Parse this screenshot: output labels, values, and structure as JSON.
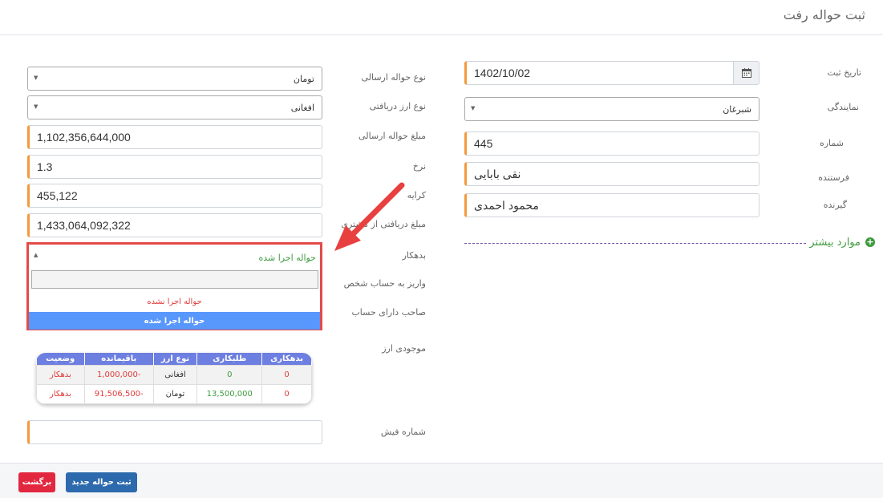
{
  "header": {
    "title": "ثبت حواله رفت"
  },
  "right_form": {
    "date_label": "تاریخ ثبت",
    "date_value": "1402/10/02",
    "agency_label": "نمایندگی",
    "agency_value": "شبرغان",
    "number_label": "شماره",
    "number_value": "445",
    "sender_label": "فرستنده",
    "sender_value": "نقی بابایی",
    "receiver_label": "گیرنده",
    "receiver_value": "محمود احمدی",
    "more_label": "موارد بیشتر"
  },
  "left_form": {
    "send_type_label": "نوع حواله ارسالی",
    "send_type_value": "تومان",
    "receive_currency_label": "نوع ارز دریافتی",
    "receive_currency_value": "افغانی",
    "send_amount_label": "مبلغ حواله ارسالی",
    "send_amount_value": "1,102,356,644,000",
    "rate_label": "نرخ",
    "rate_value": "1.3",
    "fee_label": "کرایه",
    "fee_value": "455,122",
    "received_amount_label": "مبلغ دریافتی از مشتری",
    "received_amount_value": "1,433,064,092,322",
    "debtor_label": "بدهکار",
    "deposit_label": "واریز به حساب شخص",
    "account_owner_label": "صاحب دارای حساب",
    "currency_balance_label": "موجودی ارز",
    "receipt_label": "شماره فیش",
    "receipt_value": ""
  },
  "dropdown": {
    "selected": "حواله اجرا شده",
    "search_value": "",
    "options": [
      "حواله اجرا نشده",
      "حواله اجرا شده"
    ]
  },
  "balance_table": {
    "headers": [
      "بدهکاری",
      "طلبکاری",
      "نوع ارز",
      "باقیمانده",
      "وضعیت"
    ],
    "rows": [
      [
        "0",
        "0",
        "افغانی",
        "-1,000,000",
        "بدهکار"
      ],
      [
        "0",
        "13,500,000",
        "تومان",
        "-91,506,500",
        "بدهکار"
      ]
    ]
  },
  "footer": {
    "back_label": "برگشت",
    "new_label": "ثبت حواله جدید"
  },
  "colors": {
    "accent_border": "#f29a3c",
    "highlight_red": "#e34a4a",
    "selected_option": "#5897fb",
    "table_header": "#6d7fe0",
    "more_green": "#3e9b3e",
    "back_button": "#e2283f",
    "new_button": "#2c6aad"
  },
  "icons": {
    "date": "calendar-icon",
    "more": "plus-circle-icon",
    "dropdown": "caret-down-icon",
    "annotation": "red-arrow"
  }
}
